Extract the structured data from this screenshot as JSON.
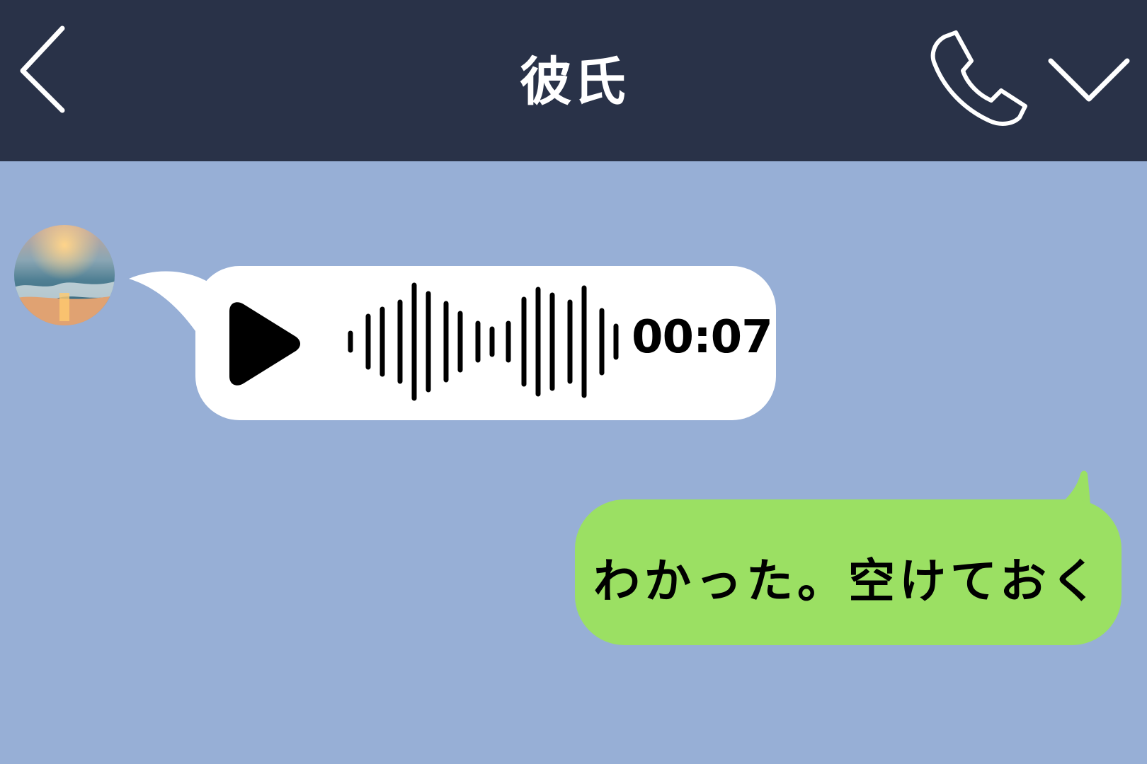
{
  "header": {
    "title": "彼氏",
    "back_icon": "chevron-left-icon",
    "call_icon": "phone-icon",
    "menu_icon": "chevron-down-icon"
  },
  "incoming": {
    "avatar": "sunset-ocean-avatar",
    "voice_message": {
      "duration": "00:07",
      "play_icon": "play-icon"
    }
  },
  "outgoing": {
    "text": "わかった。空けておく"
  },
  "colors": {
    "header_bg": "#293248",
    "chat_bg": "#97afd6",
    "incoming_bubble": "#ffffff",
    "outgoing_bubble": "#9be063"
  }
}
